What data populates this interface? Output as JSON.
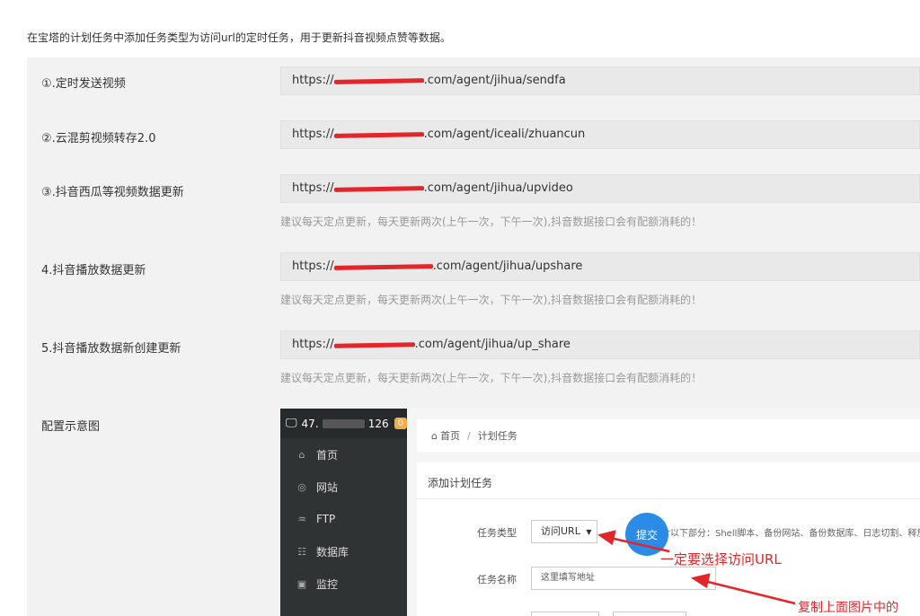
{
  "intro": "在宝塔的计划任务中添加任务类型为访问url的定时任务，用于更新抖音视频点赞等数据。",
  "rows": [
    {
      "label": "①.定时发送视频",
      "url_prefix": "https://",
      "url_suffix": ".com/agent/jihua/sendfa"
    },
    {
      "label": "②.云混剪视频转存2.0",
      "url_prefix": "https://",
      "url_suffix": ".com/agent/iceali/zhuancun"
    },
    {
      "label": "③.抖音西瓜等视频数据更新",
      "url_prefix": "https://",
      "url_suffix": ".com/agent/jihua/upvideo",
      "hint": "建议每天定点更新，每天更新两次(上午一次，下午一次),抖音数据接口会有配额消耗的！"
    },
    {
      "label": "4.抖音播放数据更新",
      "url_prefix": "https://",
      "url_suffix": ".com/agent/jihua/upshare",
      "hint": "建议每天定点更新，每天更新两次(上午一次，下午一次),抖音数据接口会有配额消耗的！"
    },
    {
      "label": "5.抖音播放数据新创建更新",
      "url_prefix": "https://",
      "url_suffix": ".com/agent/jihua/up_share",
      "hint": "建议每天定点更新，每天更新两次(上午一次，下午一次),抖音数据接口会有配额消耗的！"
    }
  ],
  "config_label": "配置示意图",
  "screenshot": {
    "server_ip_start": "47.",
    "server_ip_end": "126",
    "badge": "0",
    "nav": [
      {
        "icon": "home-icon",
        "glyph": "⌂",
        "label": "首页"
      },
      {
        "icon": "globe-icon",
        "glyph": "◎",
        "label": "网站"
      },
      {
        "icon": "ftp-icon",
        "glyph": "♒",
        "label": "FTP"
      },
      {
        "icon": "database-icon",
        "glyph": "☷",
        "label": "数据库"
      },
      {
        "icon": "monitor-icon",
        "glyph": "▣",
        "label": "监控"
      }
    ],
    "breadcrumb_home": "首页",
    "breadcrumb_sep": "/",
    "breadcrumb_current": "计划任务",
    "card_title": "添加计划任务",
    "task_type_label": "任务类型",
    "task_type_value": "访问URL",
    "task_type_desc": "含以下部分：Shell脚本、备份网站、备份数据库、日志切割、释放",
    "submit_label": "提交",
    "task_name_label": "任务名称",
    "task_name_placeholder": "这里填写地址"
  },
  "annotations": {
    "select_url": "一定要选择访问URL",
    "copy_hint": "复制上面图片中的"
  },
  "colors": {
    "annotation": "#e3262a",
    "submit": "#2a8ce6",
    "sidebar": "#2f3333"
  }
}
